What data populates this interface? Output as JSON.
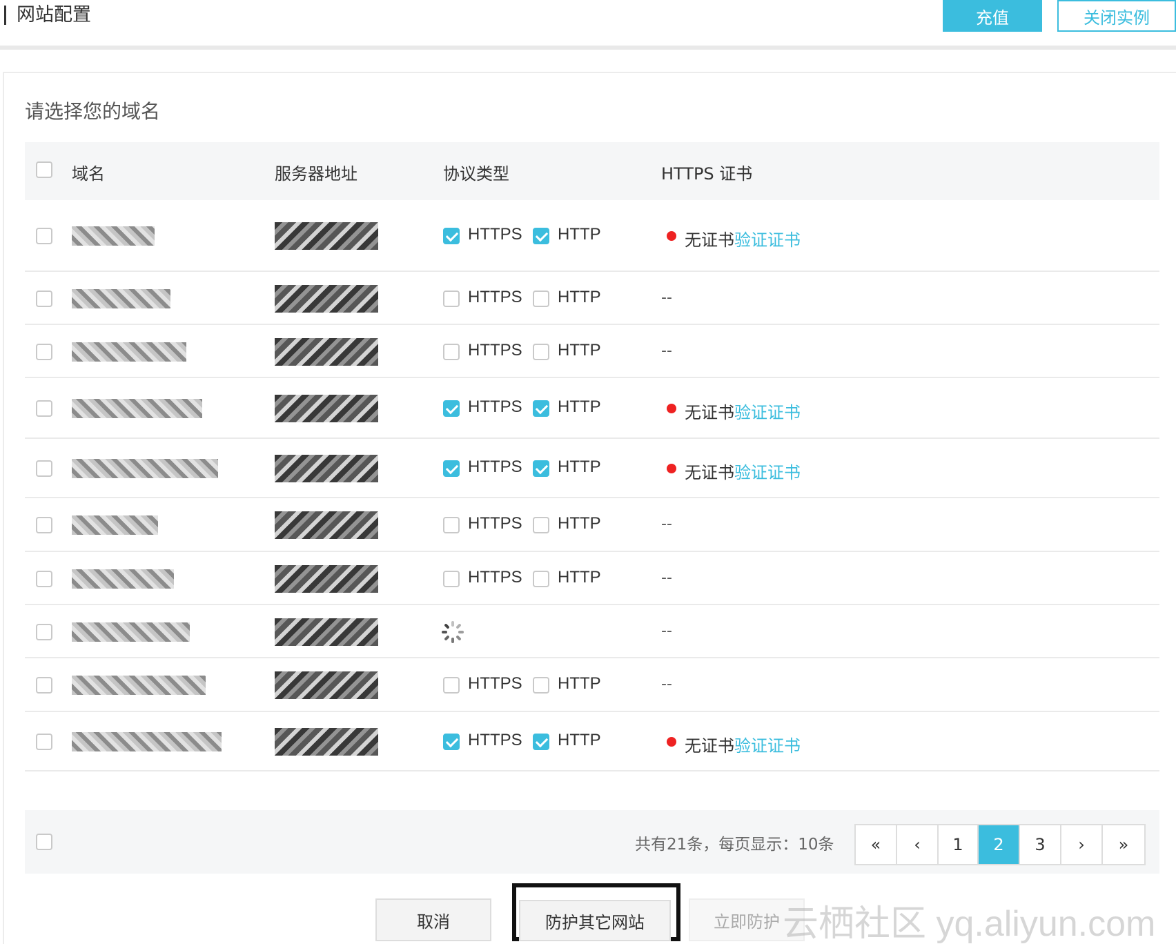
{
  "header": {
    "title": "网站配置",
    "recharge_label": "充值",
    "close_instance_label": "关闭实例"
  },
  "panel": {
    "title": "请选择您的域名"
  },
  "table": {
    "columns": [
      "域名",
      "服务器地址",
      "协议类型",
      "HTTPS 证书"
    ],
    "rows": [
      {
        "https": true,
        "http": true,
        "loading": false,
        "cert": "none"
      },
      {
        "https": false,
        "http": false,
        "loading": false,
        "cert": "dash"
      },
      {
        "https": false,
        "http": false,
        "loading": false,
        "cert": "dash"
      },
      {
        "https": true,
        "http": true,
        "loading": false,
        "cert": "none"
      },
      {
        "https": true,
        "http": true,
        "loading": false,
        "cert": "none"
      },
      {
        "https": false,
        "http": false,
        "loading": false,
        "cert": "dash"
      },
      {
        "https": false,
        "http": false,
        "loading": false,
        "cert": "dash"
      },
      {
        "https": false,
        "http": false,
        "loading": true,
        "cert": "dash"
      },
      {
        "https": false,
        "http": false,
        "loading": false,
        "cert": "dash"
      },
      {
        "https": true,
        "http": true,
        "loading": false,
        "cert": "none"
      }
    ],
    "https_label": "HTTPS",
    "http_label": "HTTP",
    "dash": "--",
    "no_cert_label": "无证书",
    "verify_cert_label": "验证证书"
  },
  "footer": {
    "summary": "共有21条，每页显示：10条",
    "pager": [
      "«",
      "‹",
      "1",
      "2",
      "3",
      "›",
      "»"
    ],
    "active_page": "2"
  },
  "actions": {
    "cancel_label": "取消",
    "protect_other_label": "防护其它网站",
    "protect_now_label": "立即防护"
  },
  "watermark": "云栖社区 yq.aliyun.com",
  "colors": {
    "accent": "#3bbdde",
    "danger_dot": "#ee2222"
  }
}
